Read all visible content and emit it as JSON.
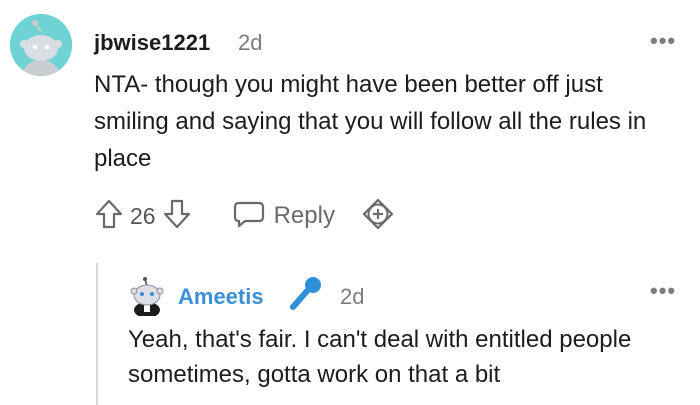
{
  "comment": {
    "username": "jbwise1221",
    "age": "2d",
    "more_label": "•••",
    "body": "NTA- though you might have been better off just smiling and saying that you will follow all the rules in place",
    "vote_count": "26",
    "reply_label": "Reply"
  },
  "reply": {
    "username": "Ameetis",
    "age": "2d",
    "more_label": "•••",
    "body": "Yeah, that's fair. I can't deal with entitled people sometimes, gotta work on that a bit"
  },
  "colors": {
    "avatar_bg": "#6fd3d3",
    "reply_username": "#3a8fd6",
    "muted": "#7c7c7c",
    "flair_mic": "#2f8fd9"
  },
  "icons": {
    "upvote": "arrow-up-icon",
    "downvote": "arrow-down-icon",
    "reply": "speech-bubble-icon",
    "award": "award-plus-icon",
    "flair": "microphone-icon"
  }
}
